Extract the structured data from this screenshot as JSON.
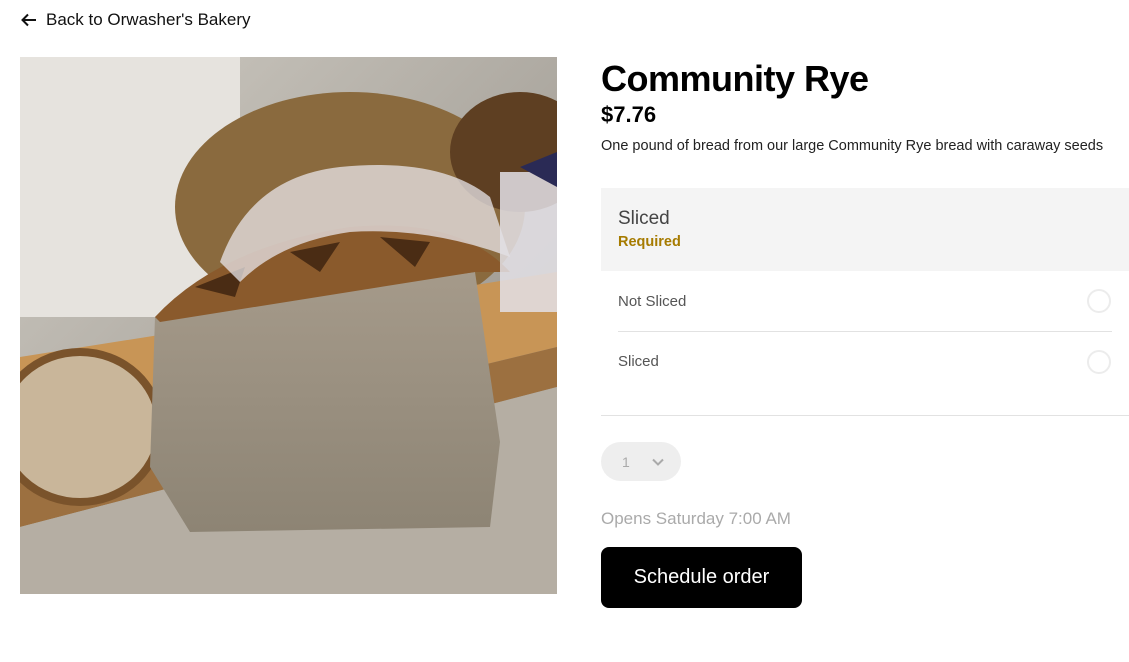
{
  "nav": {
    "back_label": "Back to Orwasher's Bakery",
    "back_icon": "arrow-left-icon"
  },
  "product": {
    "title": "Community Rye",
    "price": "$7.76",
    "description": "One pound of bread from our large Community Rye bread with caraway seeds",
    "image_subject": "loaf of rye bread held in gloved hand"
  },
  "option_group": {
    "title": "Sliced",
    "requirement": "Required",
    "options": [
      {
        "label": "Not Sliced",
        "selected": false
      },
      {
        "label": "Sliced",
        "selected": false
      }
    ]
  },
  "quantity": {
    "value": "1",
    "icon": "chevron-down-icon"
  },
  "availability": {
    "opens_text": "Opens Saturday 7:00 AM"
  },
  "actions": {
    "schedule_label": "Schedule order"
  },
  "colors": {
    "required": "#a67b00",
    "button_bg": "#000000",
    "muted_text": "#aaaaaa"
  }
}
